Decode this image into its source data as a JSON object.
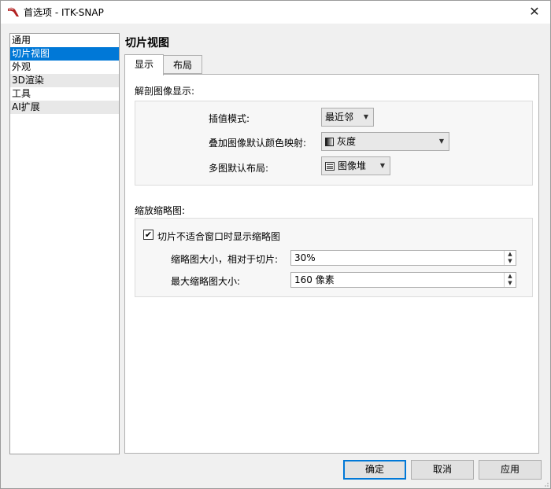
{
  "window": {
    "title": "首选项 - ITK-SNAP",
    "close_glyph": "✕",
    "app_icon": "itk-snap-logo-icon"
  },
  "sidebar": {
    "items": [
      {
        "label": "通用",
        "selected": false
      },
      {
        "label": "切片视图",
        "selected": true
      },
      {
        "label": "外观",
        "selected": false
      },
      {
        "label": "3D渲染",
        "selected": false
      },
      {
        "label": "工具",
        "selected": false
      },
      {
        "label": "AI扩展",
        "selected": false
      }
    ]
  },
  "section_title": "切片视图",
  "tabs": [
    {
      "label": "显示",
      "active": true
    },
    {
      "label": "布局",
      "active": false
    }
  ],
  "display": {
    "anatomy_group_label": "解剖图像显示:",
    "interpolation": {
      "label": "插值模式:",
      "value": "最近邻"
    },
    "overlay_colormap": {
      "label": "叠加图像默认颜色映射:",
      "value": "灰度",
      "icon": "grayscale-gradient-icon"
    },
    "multi_image_layout": {
      "label": "多图默认布局:",
      "value": "图像堆",
      "icon": "image-stack-icon"
    },
    "thumbnail_group_label": "缩放缩略图:",
    "show_thumbnail": {
      "label": "切片不适合窗口时显示缩略图",
      "checked": true
    },
    "thumbnail_size": {
      "label": "缩略图大小，相对于切片:",
      "value": "30%"
    },
    "max_thumbnail_size": {
      "label": "最大缩略图大小:",
      "value": "160 像素"
    }
  },
  "buttons": {
    "ok": "确定",
    "cancel": "取消",
    "apply": "应用"
  }
}
